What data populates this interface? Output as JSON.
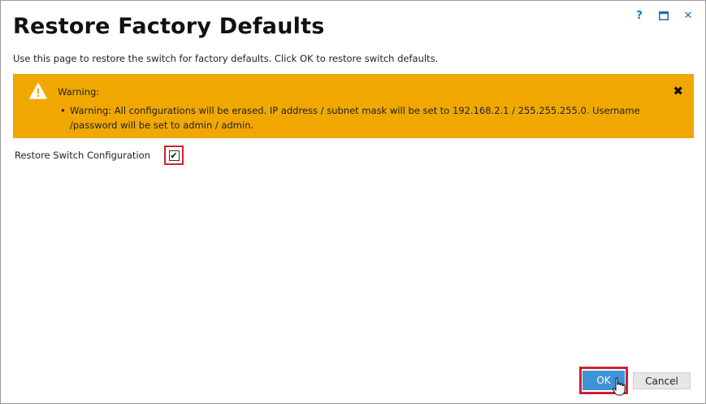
{
  "window": {
    "help_glyph": "?",
    "maximize_glyph": "□",
    "close_glyph": "✕"
  },
  "header": {
    "title": "Restore Factory Defaults",
    "description": "Use this page to restore the switch for factory defaults. Click OK to restore switch defaults."
  },
  "warning": {
    "title": "Warning:",
    "message": "Warning: All configurations will be erased. IP address / subnet mask will be set to 192.168.2.1 / 255.255.255.0. Username /password will be set to admin / admin.",
    "close_glyph": "✖",
    "color": "#f0a800"
  },
  "form": {
    "restore_label": "Restore Switch Configuration",
    "restore_checked": true,
    "check_glyph": "✔"
  },
  "buttons": {
    "ok_label": "OK",
    "cancel_label": "Cancel",
    "ok_color": "#3d94d6"
  },
  "highlight_color": "#d12030"
}
